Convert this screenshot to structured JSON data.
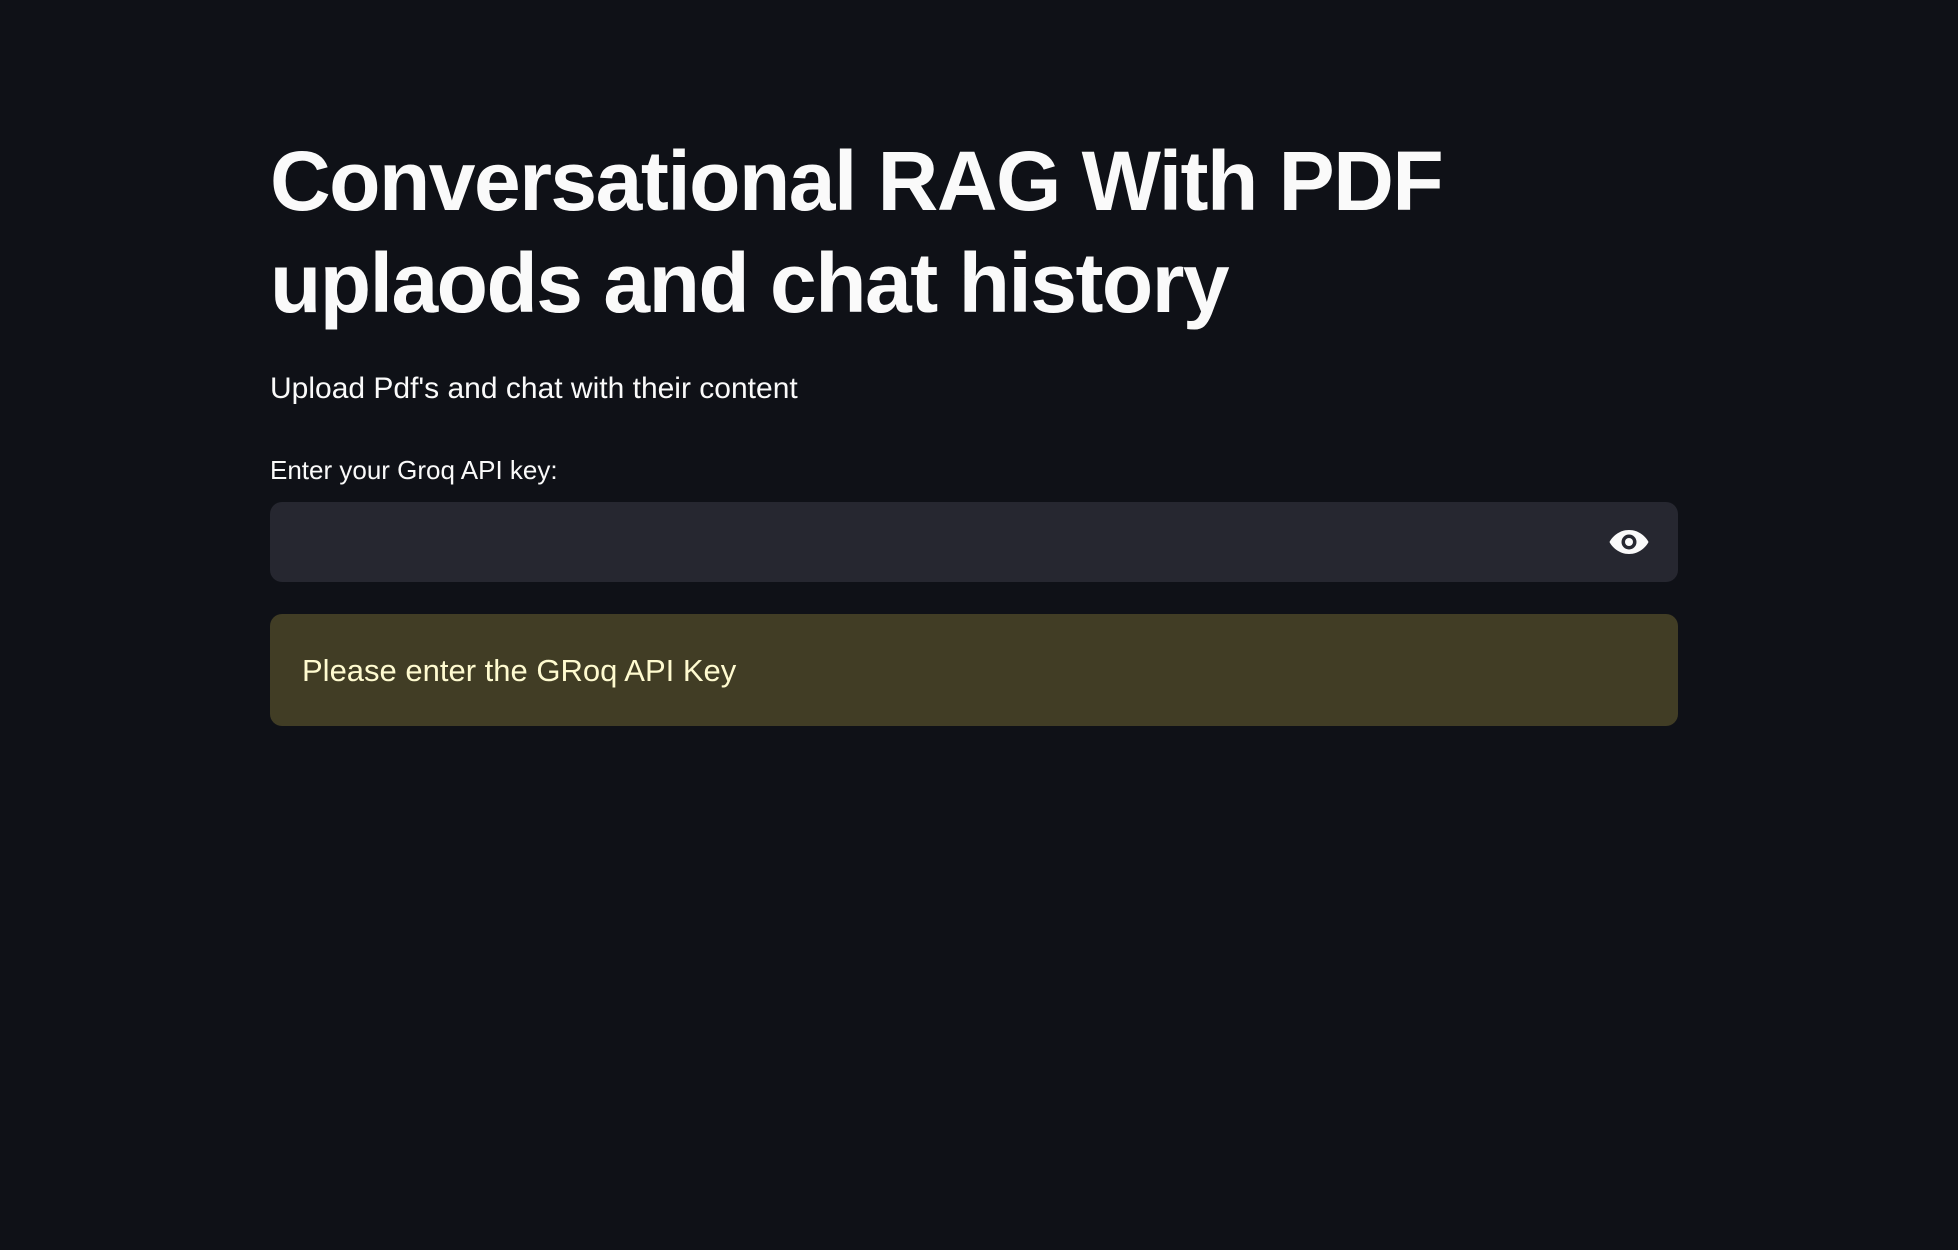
{
  "main": {
    "title": "Conversational RAG With PDF uplaods and chat history",
    "subtitle": "Upload Pdf's and chat with their content",
    "api_key_field": {
      "label": "Enter your Groq API key:",
      "value": "",
      "placeholder": "",
      "toggle_icon": "eye-icon"
    },
    "warning": {
      "text": "Please enter the GRoq API Key"
    }
  },
  "colors": {
    "background": "#0f1117",
    "input_background": "#262730",
    "warning_background": "#413d25",
    "warning_text": "#fffbd0",
    "text": "#fafafa"
  }
}
